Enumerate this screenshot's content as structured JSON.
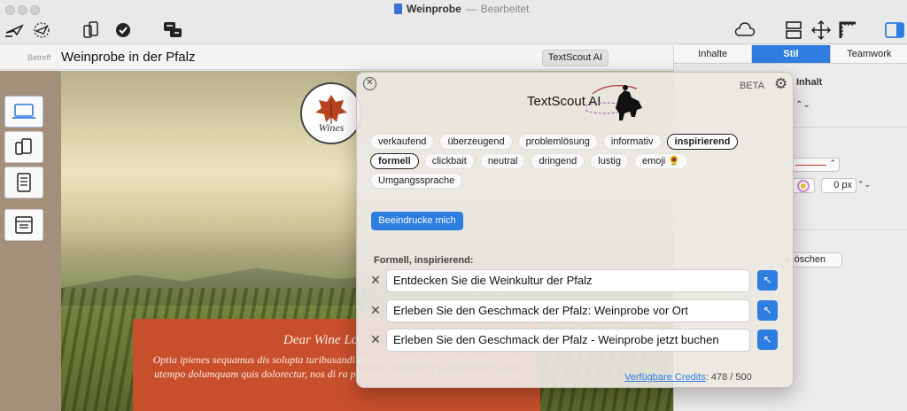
{
  "window": {
    "doc_name": "Weinprobe",
    "separator": "—",
    "status": "Bearbeitet"
  },
  "subject": {
    "label": "Betreff",
    "value": "Weinprobe in der Pfalz",
    "textscout_button": "TextScout AI"
  },
  "inspector": {
    "tabs": [
      {
        "label": "Inhalte"
      },
      {
        "label": "Stil"
      },
      {
        "label": "Teamwork"
      }
    ],
    "active_tab": "Stil",
    "section_title_fragment": "Inhalt",
    "px_value": "0 px",
    "delete_button_fragment": "d löschen"
  },
  "canvas": {
    "logo_text": "Wines",
    "heading": "Dear Wine Lo",
    "body": "Optia ipienes sequamus dis solupta turibusandi aliciae voloresequae volluptibus, solori utempo dolumquam quis dolorectur, nos di ra perions, auruerue. Tassition cone et etur."
  },
  "popover": {
    "beta_label": "BETA",
    "brand": "TextScout AI",
    "tones": [
      {
        "label": "verkaufend",
        "selected": false
      },
      {
        "label": "überzeugend",
        "selected": false
      },
      {
        "label": "problemlösung",
        "selected": false
      },
      {
        "label": "informativ",
        "selected": false
      },
      {
        "label": "inspirierend",
        "selected": true
      },
      {
        "label": "formell",
        "selected": true
      },
      {
        "label": "clickbait",
        "selected": false
      },
      {
        "label": "neutral",
        "selected": false
      },
      {
        "label": "dringend",
        "selected": false
      },
      {
        "label": "lustig",
        "selected": false
      },
      {
        "label": "emoji 🌻",
        "selected": false
      },
      {
        "label": "Umgangssprache",
        "selected": false
      }
    ],
    "impress_button": "Beeindrucke mich",
    "result_label": "Formell, inspirierend:",
    "results": [
      {
        "text": "Entdecken Sie die Weinkultur der Pfalz"
      },
      {
        "text": "Erleben Sie den Geschmack der Pfalz: Weinprobe vor Ort"
      },
      {
        "text": "Erleben Sie den Geschmack der Pfalz - Weinprobe jetzt buchen"
      }
    ],
    "credits_link": "Verfügbare Credits",
    "credits_value": "478 / 500"
  },
  "colors": {
    "accent": "#2e7de1",
    "banner": "#c94f2c"
  }
}
